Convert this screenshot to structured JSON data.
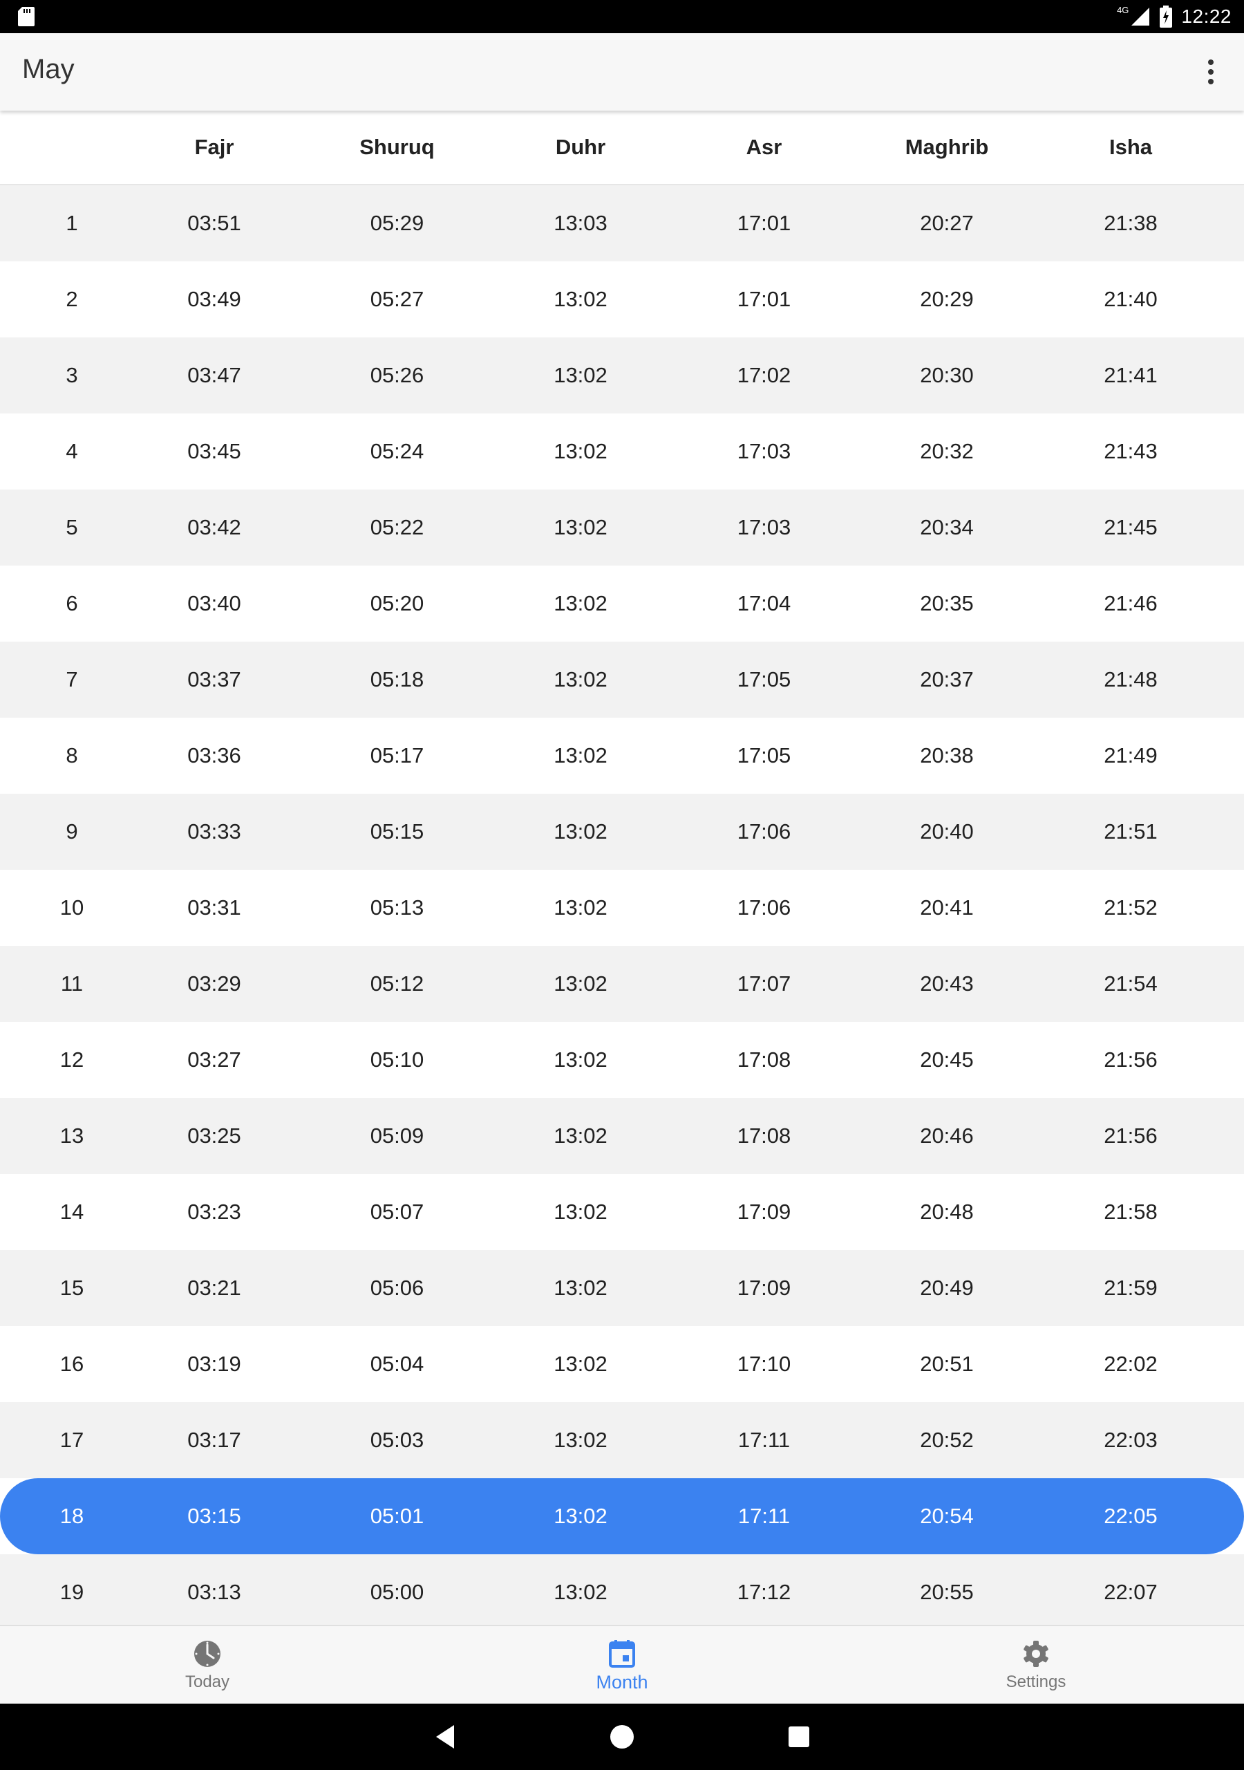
{
  "status_bar": {
    "network": "4G",
    "time": "12:22",
    "icons": [
      "sd-card-icon",
      "signal-icon",
      "battery-icon"
    ]
  },
  "app_bar": {
    "title": "May",
    "menu_icon": "more-vert-icon"
  },
  "table": {
    "headers": [
      "",
      "Fajr",
      "Shuruq",
      "Duhr",
      "Asr",
      "Maghrib",
      "Isha"
    ],
    "rows": [
      [
        "1",
        "03:51",
        "05:29",
        "13:03",
        "17:01",
        "20:27",
        "21:38"
      ],
      [
        "2",
        "03:49",
        "05:27",
        "13:02",
        "17:01",
        "20:29",
        "21:40"
      ],
      [
        "3",
        "03:47",
        "05:26",
        "13:02",
        "17:02",
        "20:30",
        "21:41"
      ],
      [
        "4",
        "03:45",
        "05:24",
        "13:02",
        "17:03",
        "20:32",
        "21:43"
      ],
      [
        "5",
        "03:42",
        "05:22",
        "13:02",
        "17:03",
        "20:34",
        "21:45"
      ],
      [
        "6",
        "03:40",
        "05:20",
        "13:02",
        "17:04",
        "20:35",
        "21:46"
      ],
      [
        "7",
        "03:37",
        "05:18",
        "13:02",
        "17:05",
        "20:37",
        "21:48"
      ],
      [
        "8",
        "03:36",
        "05:17",
        "13:02",
        "17:05",
        "20:38",
        "21:49"
      ],
      [
        "9",
        "03:33",
        "05:15",
        "13:02",
        "17:06",
        "20:40",
        "21:51"
      ],
      [
        "10",
        "03:31",
        "05:13",
        "13:02",
        "17:06",
        "20:41",
        "21:52"
      ],
      [
        "11",
        "03:29",
        "05:12",
        "13:02",
        "17:07",
        "20:43",
        "21:54"
      ],
      [
        "12",
        "03:27",
        "05:10",
        "13:02",
        "17:08",
        "20:45",
        "21:56"
      ],
      [
        "13",
        "03:25",
        "05:09",
        "13:02",
        "17:08",
        "20:46",
        "21:56"
      ],
      [
        "14",
        "03:23",
        "05:07",
        "13:02",
        "17:09",
        "20:48",
        "21:58"
      ],
      [
        "15",
        "03:21",
        "05:06",
        "13:02",
        "17:09",
        "20:49",
        "21:59"
      ],
      [
        "16",
        "03:19",
        "05:04",
        "13:02",
        "17:10",
        "20:51",
        "22:02"
      ],
      [
        "17",
        "03:17",
        "05:03",
        "13:02",
        "17:11",
        "20:52",
        "22:03"
      ],
      [
        "18",
        "03:15",
        "05:01",
        "13:02",
        "17:11",
        "20:54",
        "22:05"
      ],
      [
        "19",
        "03:13",
        "05:00",
        "13:02",
        "17:12",
        "20:55",
        "22:07"
      ]
    ],
    "current_day": "18"
  },
  "bottom_nav": {
    "items": [
      {
        "label": "Today",
        "icon": "clock-icon",
        "active": false
      },
      {
        "label": "Month",
        "icon": "calendar-icon",
        "active": true
      },
      {
        "label": "Settings",
        "icon": "gear-icon",
        "active": false
      }
    ]
  },
  "colors": {
    "accent": "#3b82f0",
    "row_stripe": "#f2f2f2",
    "app_bar": "#f7f7f7",
    "inactive_nav": "#757575"
  },
  "system_nav": {
    "buttons": [
      "back-icon",
      "home-icon",
      "recents-icon"
    ]
  }
}
